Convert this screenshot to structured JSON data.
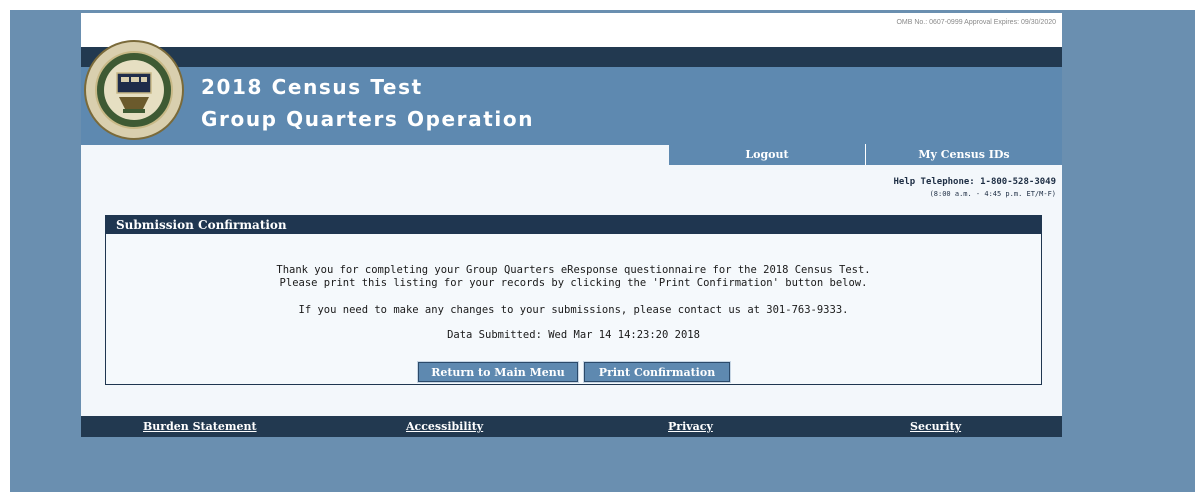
{
  "header": {
    "omb_notice": "OMB No.: 0607-0999 Approval Expires: 09/30/2020",
    "title_line1": "2018 Census Test",
    "title_line2": "Group Quarters Operation",
    "seal_icon": "census-bureau-seal-icon"
  },
  "nav": {
    "logout": "Logout",
    "my_census_ids": "My Census IDs"
  },
  "help": {
    "phone": "Help Telephone: 1-800-528-3049",
    "hours": "(8:00 a.m. - 4:45 p.m. ET/M-F)"
  },
  "confirmation": {
    "heading": "Submission Confirmation",
    "line1": "Thank you for completing your Group Quarters eResponse questionnaire for the 2018 Census Test.",
    "line2": "Please print this listing for your records by clicking the 'Print Confirmation' button below.",
    "line3": "If you need to make any changes to your submissions, please contact us at 301-763-9333.",
    "line4": "Data Submitted: Wed Mar 14 14:23:20 2018",
    "return_button": "Return to Main Menu",
    "print_button": "Print Confirmation"
  },
  "footer": {
    "burden": "Burden Statement",
    "accessibility": "Accessibility",
    "privacy": "Privacy",
    "security": "Security"
  },
  "colors": {
    "backdrop": "#6a8fb0",
    "banner": "#5e89b0",
    "dark_navy": "#223950",
    "page_bg": "#f3f7fb"
  }
}
